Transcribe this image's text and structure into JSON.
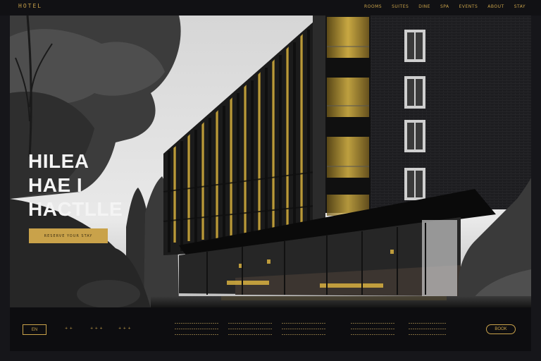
{
  "header": {
    "logo": "HOTEL",
    "nav": [
      "ROOMS",
      "SUITES",
      "DINE",
      "SPA",
      "EVENTS",
      "ABOUT",
      "STAY"
    ]
  },
  "hero": {
    "headline": [
      "HILEA",
      "HAE I",
      "HACTLLE"
    ],
    "cta_label": "RESERVE YOUR STAY",
    "image_alt": "hotel-building-photo"
  },
  "footer": {
    "button_label": "EN",
    "links": [
      "+ +",
      "+ + +",
      "+ + +"
    ],
    "pill_label": "BOOK"
  },
  "colors": {
    "gold": "#c9a24a",
    "dark": "#0d0d10",
    "headline": "#f4f4f4"
  }
}
